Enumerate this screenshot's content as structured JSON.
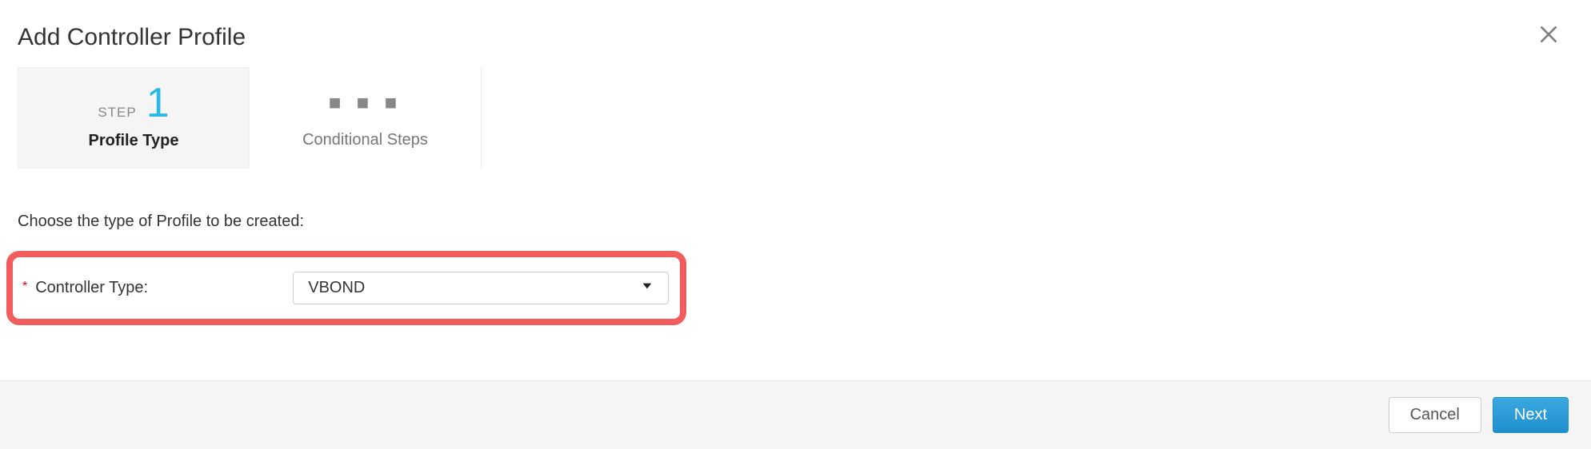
{
  "dialog": {
    "title": "Add Controller Profile"
  },
  "steps": {
    "current": {
      "prefix": "STEP",
      "number": "1",
      "name": "Profile Type"
    },
    "next": {
      "dots": "■ ■ ■",
      "name": "Conditional Steps"
    }
  },
  "prompt": "Choose the type of Profile to be created:",
  "form": {
    "required_mark": "*",
    "controller_type_label": "Controller Type:",
    "controller_type_value": "VBOND"
  },
  "footer": {
    "cancel": "Cancel",
    "next": "Next"
  }
}
